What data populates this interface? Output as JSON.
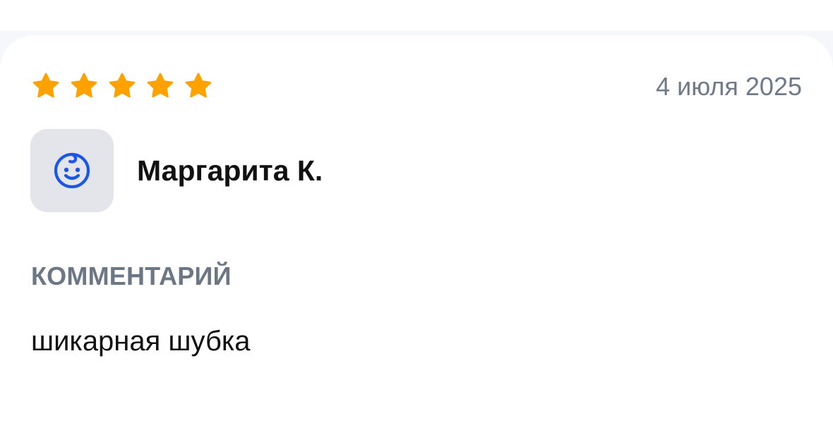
{
  "review": {
    "rating": 5,
    "rating_max": 5,
    "date": "4 июля 2025",
    "author": {
      "name": "Маргарита К.",
      "avatar_icon": "baby-face-icon"
    },
    "comment_heading": "КОММЕНТАРИЙ",
    "comment_text": "шикарная шубка"
  },
  "colors": {
    "star": "#ffa200",
    "avatar_background": "#e3e5ea",
    "avatar_icon": "#1a56e8",
    "muted_text": "#6f7a88",
    "primary_text": "#111111",
    "page_background": "#f6f7fb",
    "card_background": "#ffffff"
  }
}
